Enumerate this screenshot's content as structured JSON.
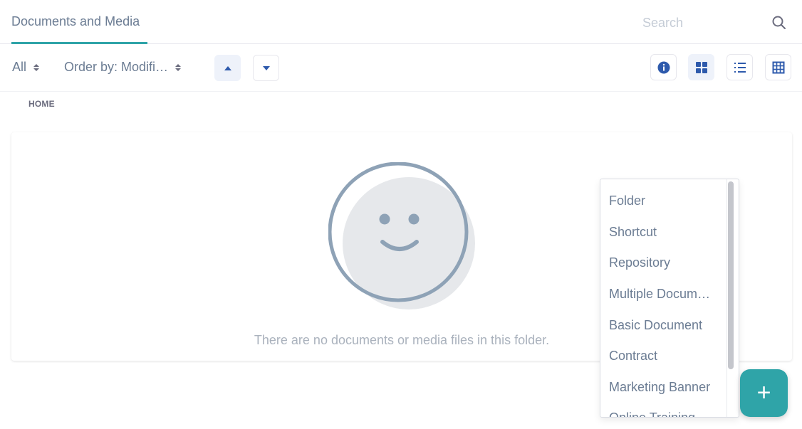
{
  "header": {
    "tab_label": "Documents and Media",
    "search_placeholder": "Search"
  },
  "toolbar": {
    "filter_label": "All",
    "order_label": "Order by: Modifi…",
    "sort_ascending_icon": "arrow-up-icon",
    "sort_descending_icon": "arrow-down-icon",
    "view_buttons": [
      "info-icon",
      "cards-icon",
      "list-icon",
      "table-icon"
    ],
    "active_view": "cards"
  },
  "breadcrumb": "HOME",
  "empty_state": {
    "message": "There are no documents or media files in this folder."
  },
  "add_menu": {
    "items": [
      "Folder",
      "Shortcut",
      "Repository",
      "Multiple Docum…",
      "Basic Document",
      "Contract",
      "Marketing Banner",
      "Online Training"
    ]
  },
  "fab_label": "+",
  "colors": {
    "accent": "#2fa4a8",
    "primary": "#2e5aac",
    "text": "#6b7c93"
  }
}
